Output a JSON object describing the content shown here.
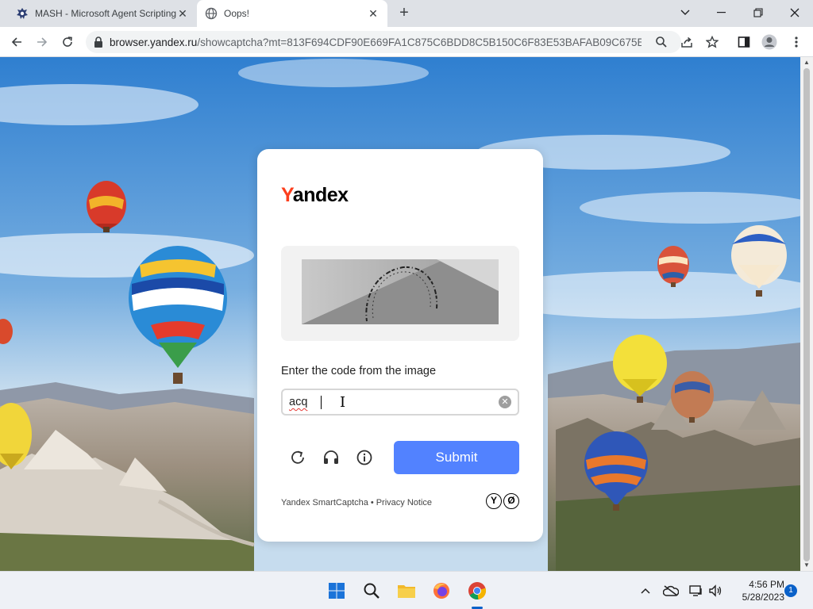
{
  "browser": {
    "tabs": [
      {
        "title": "MASH - Microsoft Agent Scripting",
        "active": false
      },
      {
        "title": "Oops!",
        "active": true
      }
    ],
    "address": {
      "host": "browser.yandex.ru",
      "path": "/showcaptcha?mt=813F694CDF90E669FA1C875C6BDD8C5B150C6F83E53BAFAB09C675E..."
    }
  },
  "captcha": {
    "brand_first": "Y",
    "brand_rest": "andex",
    "prompt": "Enter the code from the image",
    "input_value": "acq",
    "submit_label": "Submit",
    "footer_text": "Yandex SmartCaptcha",
    "footer_separator": "•",
    "footer_link": "Privacy Notice",
    "logo_letters": [
      "Y",
      "Ø"
    ]
  },
  "taskbar": {
    "time": "4:56 PM",
    "date": "5/28/2023",
    "notification_count": "1"
  },
  "colors": {
    "submit_button": "#5282ff",
    "brand_accent": "#fc3f1d",
    "taskbar_accent": "#0a61c9"
  }
}
